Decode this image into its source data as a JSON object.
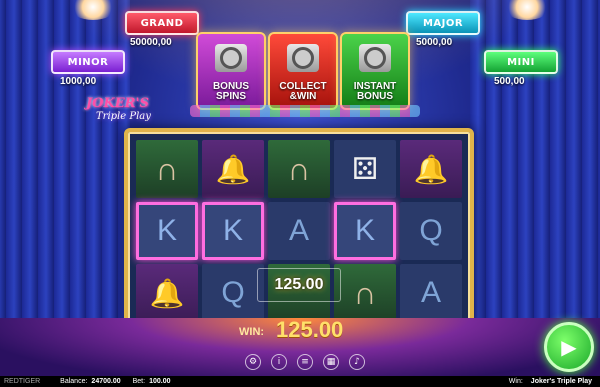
{
  "jackpots": {
    "grand": {
      "label": "GRAND",
      "value": "50000,00"
    },
    "major": {
      "label": "MAJOR",
      "value": "5000,00"
    },
    "minor": {
      "label": "MINOR",
      "value": "1000,00"
    },
    "mini": {
      "label": "MINI",
      "value": "500,00"
    }
  },
  "features": {
    "bonus": {
      "line1": "BONUS",
      "line2": "SPINS"
    },
    "collect": {
      "line1": "COLLECT",
      "line2": "&WIN"
    },
    "instant": {
      "line1": "INSTANT",
      "line2": "BONUS"
    }
  },
  "logo": {
    "top": "JOKER'S",
    "bottom": "Triple Play"
  },
  "reels": [
    [
      "horseshoe",
      "bell",
      "horseshoe",
      "dice",
      "bell"
    ],
    [
      "K",
      "K",
      "A",
      "K",
      "Q"
    ],
    [
      "bell",
      "Q",
      "wild",
      "horseshoe",
      "A"
    ]
  ],
  "reel_text": {
    "r1c0": "K",
    "r1c1": "K",
    "r1c2": "A",
    "r1c3": "K",
    "r1c4": "Q",
    "r2c1": "Q",
    "r2c4": "A"
  },
  "win_overlay": "125.00",
  "win": {
    "label": "WIN:",
    "amount": "125.00"
  },
  "bottom_bar": {
    "brand": "REDTIGER",
    "balance_label": "Balance:",
    "balance": "24700.00",
    "bet_label": "Bet:",
    "bet": "100.00",
    "win_label": "Win:",
    "game": "Joker's Triple Play"
  },
  "icons": [
    "settings-icon",
    "info-icon",
    "stack-icon",
    "grid-icon",
    "sound-icon",
    "play-icon"
  ],
  "colors": {
    "grand": "#ff3b55",
    "major": "#2ae0ff",
    "minor": "#b04fff",
    "mini": "#2fff55",
    "accent": "#ffd16a"
  }
}
